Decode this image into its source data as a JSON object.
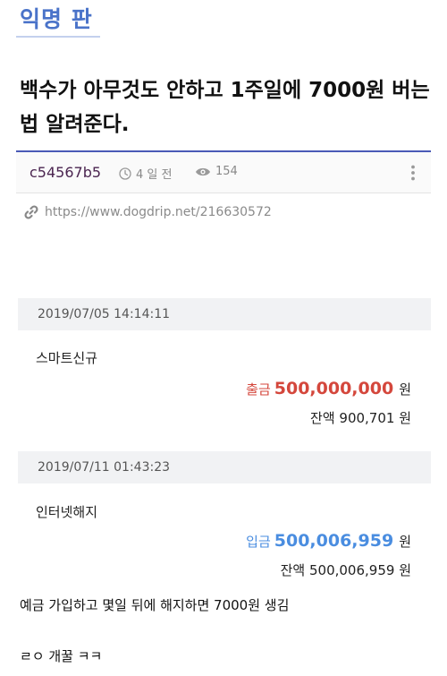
{
  "board": {
    "title": "익명 판"
  },
  "post": {
    "title": "백수가 아무것도 안하고 1주일에 7000원 버는법 알려준다.",
    "author": "c54567b5",
    "time": "4 일 전",
    "views": "154",
    "url": "https://www.dogdrip.net/216630572"
  },
  "transactions": [
    {
      "datetime": "2019/07/05 14:14:11",
      "description": "스마트신규",
      "type_label": "출금",
      "amount": "500,000,000",
      "unit": "원",
      "balance": "잔액 900,701 원",
      "color": "#d4473c"
    },
    {
      "datetime": "2019/07/11 01:43:23",
      "description": "인터넷해지",
      "type_label": "입금",
      "amount": "500,006,959",
      "unit": "원",
      "balance": "잔액 500,006,959 원",
      "color": "#4a8de0"
    }
  ],
  "content": {
    "line1": "예금 가입하고 몇일 뒤에 해지하면 7000원 생김",
    "line2": "ㄹㅇ 개꿀 ㅋㅋ"
  },
  "icons": {
    "clock": "clock-icon",
    "views": "eye-icon",
    "more": "more-vertical-icon",
    "link": "link-icon"
  },
  "colors": {
    "accent": "#4a73c9",
    "divider": "#4a5ab6",
    "withdraw": "#d4473c",
    "deposit": "#4a8de0"
  }
}
